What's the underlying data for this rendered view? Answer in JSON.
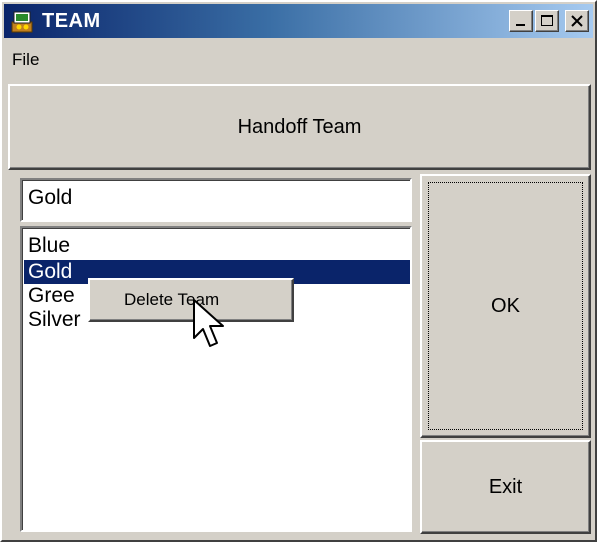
{
  "window": {
    "title": "TEAM",
    "controls": [
      "minimize",
      "maximize",
      "close"
    ]
  },
  "menubar": {
    "items": [
      {
        "label": "File"
      }
    ]
  },
  "handoff_button": {
    "label": "Handoff Team"
  },
  "team_input": {
    "value": "Gold"
  },
  "team_list": {
    "items": [
      {
        "label": "Blue",
        "selected": false
      },
      {
        "label": "Gold",
        "selected": true
      },
      {
        "label": "Gree",
        "selected": false
      },
      {
        "label": "Silver",
        "selected": false
      }
    ]
  },
  "context_menu": {
    "items": [
      {
        "label": "Delete Team"
      }
    ]
  },
  "buttons": {
    "ok_label": "OK",
    "exit_label": "Exit"
  },
  "colors": {
    "face": "#d4d0c8",
    "titlebar_start": "#0a246a",
    "titlebar_end": "#a6caf0",
    "selection": "#0a246a"
  },
  "icons": [
    "team-app-icon",
    "minimize-icon",
    "maximize-icon",
    "close-icon",
    "arrow-cursor-icon"
  ]
}
